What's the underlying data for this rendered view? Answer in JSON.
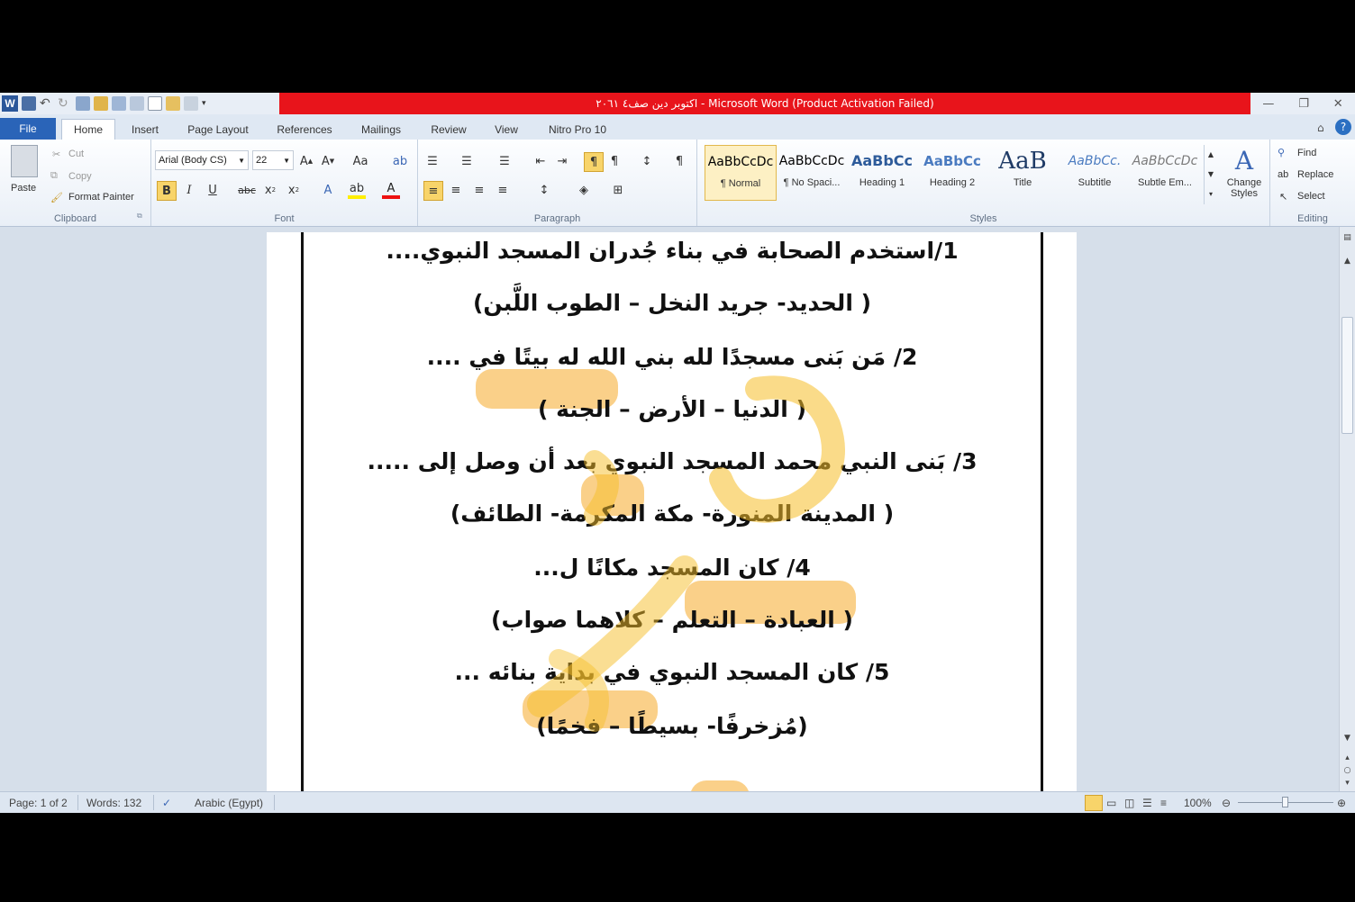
{
  "window": {
    "title": "اكتوبر دين صف٤ ٢٠٦١ - Microsoft Word (Product Activation Failed)"
  },
  "tabs": [
    "File",
    "Home",
    "Insert",
    "Page Layout",
    "References",
    "Mailings",
    "Review",
    "View",
    "Nitro Pro 10"
  ],
  "clipboard": {
    "paste": "Paste",
    "cut": "Cut",
    "copy": "Copy",
    "format_painter": "Format Painter",
    "label": "Clipboard"
  },
  "font": {
    "name": "Arial (Body CS)",
    "size": "22",
    "label": "Font"
  },
  "paragraph": {
    "label": "Paragraph"
  },
  "styles": {
    "label": "Styles",
    "items": [
      {
        "preview": "AaBbCcDc",
        "name": "¶ Normal"
      },
      {
        "preview": "AaBbCcDc",
        "name": "¶ No Spaci..."
      },
      {
        "preview": "AaBbCc",
        "name": "Heading 1"
      },
      {
        "preview": "AaBbCc",
        "name": "Heading 2"
      },
      {
        "preview": "AaB",
        "name": "Title"
      },
      {
        "preview": "AaBbCc.",
        "name": "Subtitle"
      },
      {
        "preview": "AaBbCcDc",
        "name": "Subtle Em..."
      }
    ],
    "change_styles": "Change Styles"
  },
  "editing": {
    "find": "Find",
    "replace": "Replace",
    "select": "Select",
    "label": "Editing"
  },
  "document": {
    "lines": [
      "1/استخدم الصحابة في بناء جُدران المسجد النبوي....",
      "( الحديد- جريد النخل – الطوب اللَّبن)",
      "2/ مَن بَنى مسجدًا لله بني الله له بيتًا في ....",
      "( الدنيا – الأرض – الجنة )",
      "3/ بَنى النبي محمد المسجد النبوي بعد أن وصل إلى .....",
      "( المدينة المنورة- مكة المكرمة- الطائف)",
      "4/ كان المسجد مكانًا ل...",
      "( العبادة – التعلم – كلاهما صواب)",
      "5/ كان المسجد النبوي في بداية بنائه ...",
      "(مُزخرفًا- بسيطًا – فخمًا)"
    ]
  },
  "status": {
    "page": "Page: 1 of 2",
    "words": "Words: 132",
    "language": "Arabic (Egypt)",
    "zoom": "100%"
  },
  "colors": {
    "title_bar_red": "#e8141b",
    "file_tab": "#2a64b8",
    "highlight": "#f6aa28"
  }
}
